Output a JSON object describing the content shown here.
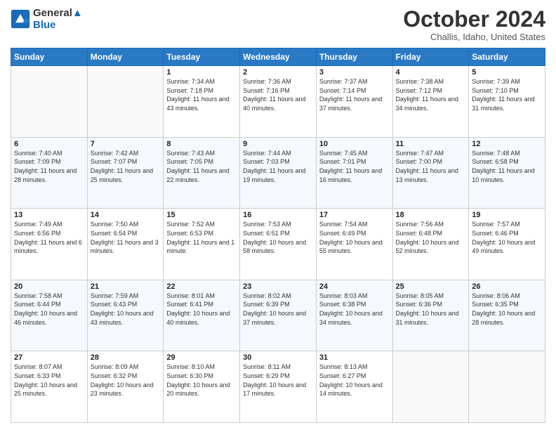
{
  "header": {
    "logo_line1": "General",
    "logo_line2": "Blue",
    "month": "October 2024",
    "location": "Challis, Idaho, United States"
  },
  "weekdays": [
    "Sunday",
    "Monday",
    "Tuesday",
    "Wednesday",
    "Thursday",
    "Friday",
    "Saturday"
  ],
  "weeks": [
    [
      {
        "day": "",
        "info": ""
      },
      {
        "day": "",
        "info": ""
      },
      {
        "day": "1",
        "info": "Sunrise: 7:34 AM\nSunset: 7:18 PM\nDaylight: 11 hours and 43 minutes."
      },
      {
        "day": "2",
        "info": "Sunrise: 7:36 AM\nSunset: 7:16 PM\nDaylight: 11 hours and 40 minutes."
      },
      {
        "day": "3",
        "info": "Sunrise: 7:37 AM\nSunset: 7:14 PM\nDaylight: 11 hours and 37 minutes."
      },
      {
        "day": "4",
        "info": "Sunrise: 7:38 AM\nSunset: 7:12 PM\nDaylight: 11 hours and 34 minutes."
      },
      {
        "day": "5",
        "info": "Sunrise: 7:39 AM\nSunset: 7:10 PM\nDaylight: 11 hours and 31 minutes."
      }
    ],
    [
      {
        "day": "6",
        "info": "Sunrise: 7:40 AM\nSunset: 7:09 PM\nDaylight: 11 hours and 28 minutes."
      },
      {
        "day": "7",
        "info": "Sunrise: 7:42 AM\nSunset: 7:07 PM\nDaylight: 11 hours and 25 minutes."
      },
      {
        "day": "8",
        "info": "Sunrise: 7:43 AM\nSunset: 7:05 PM\nDaylight: 11 hours and 22 minutes."
      },
      {
        "day": "9",
        "info": "Sunrise: 7:44 AM\nSunset: 7:03 PM\nDaylight: 11 hours and 19 minutes."
      },
      {
        "day": "10",
        "info": "Sunrise: 7:45 AM\nSunset: 7:01 PM\nDaylight: 11 hours and 16 minutes."
      },
      {
        "day": "11",
        "info": "Sunrise: 7:47 AM\nSunset: 7:00 PM\nDaylight: 11 hours and 13 minutes."
      },
      {
        "day": "12",
        "info": "Sunrise: 7:48 AM\nSunset: 6:58 PM\nDaylight: 11 hours and 10 minutes."
      }
    ],
    [
      {
        "day": "13",
        "info": "Sunrise: 7:49 AM\nSunset: 6:56 PM\nDaylight: 11 hours and 6 minutes."
      },
      {
        "day": "14",
        "info": "Sunrise: 7:50 AM\nSunset: 6:54 PM\nDaylight: 11 hours and 3 minutes."
      },
      {
        "day": "15",
        "info": "Sunrise: 7:52 AM\nSunset: 6:53 PM\nDaylight: 11 hours and 1 minute."
      },
      {
        "day": "16",
        "info": "Sunrise: 7:53 AM\nSunset: 6:51 PM\nDaylight: 10 hours and 58 minutes."
      },
      {
        "day": "17",
        "info": "Sunrise: 7:54 AM\nSunset: 6:49 PM\nDaylight: 10 hours and 55 minutes."
      },
      {
        "day": "18",
        "info": "Sunrise: 7:56 AM\nSunset: 6:48 PM\nDaylight: 10 hours and 52 minutes."
      },
      {
        "day": "19",
        "info": "Sunrise: 7:57 AM\nSunset: 6:46 PM\nDaylight: 10 hours and 49 minutes."
      }
    ],
    [
      {
        "day": "20",
        "info": "Sunrise: 7:58 AM\nSunset: 6:44 PM\nDaylight: 10 hours and 46 minutes."
      },
      {
        "day": "21",
        "info": "Sunrise: 7:59 AM\nSunset: 6:43 PM\nDaylight: 10 hours and 43 minutes."
      },
      {
        "day": "22",
        "info": "Sunrise: 8:01 AM\nSunset: 6:41 PM\nDaylight: 10 hours and 40 minutes."
      },
      {
        "day": "23",
        "info": "Sunrise: 8:02 AM\nSunset: 6:39 PM\nDaylight: 10 hours and 37 minutes."
      },
      {
        "day": "24",
        "info": "Sunrise: 8:03 AM\nSunset: 6:38 PM\nDaylight: 10 hours and 34 minutes."
      },
      {
        "day": "25",
        "info": "Sunrise: 8:05 AM\nSunset: 6:36 PM\nDaylight: 10 hours and 31 minutes."
      },
      {
        "day": "26",
        "info": "Sunrise: 8:06 AM\nSunset: 6:35 PM\nDaylight: 10 hours and 28 minutes."
      }
    ],
    [
      {
        "day": "27",
        "info": "Sunrise: 8:07 AM\nSunset: 6:33 PM\nDaylight: 10 hours and 25 minutes."
      },
      {
        "day": "28",
        "info": "Sunrise: 8:09 AM\nSunset: 6:32 PM\nDaylight: 10 hours and 23 minutes."
      },
      {
        "day": "29",
        "info": "Sunrise: 8:10 AM\nSunset: 6:30 PM\nDaylight: 10 hours and 20 minutes."
      },
      {
        "day": "30",
        "info": "Sunrise: 8:11 AM\nSunset: 6:29 PM\nDaylight: 10 hours and 17 minutes."
      },
      {
        "day": "31",
        "info": "Sunrise: 8:13 AM\nSunset: 6:27 PM\nDaylight: 10 hours and 14 minutes."
      },
      {
        "day": "",
        "info": ""
      },
      {
        "day": "",
        "info": ""
      }
    ]
  ]
}
